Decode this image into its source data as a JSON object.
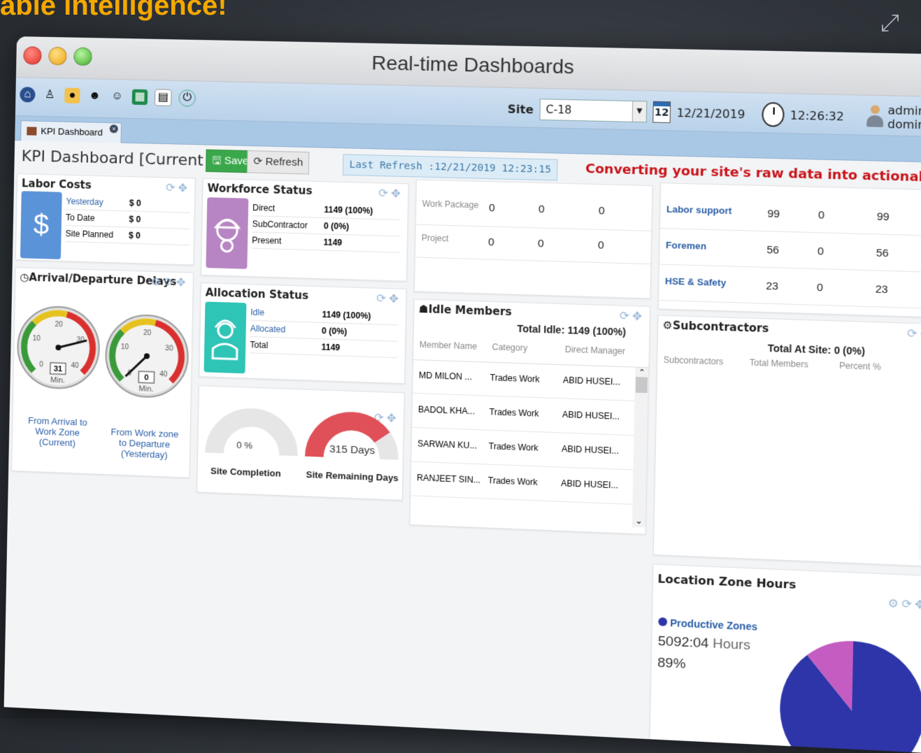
{
  "headline": "able intelligence!",
  "window": {
    "title": "Real-time Dashboards"
  },
  "toolbar": {
    "site_label": "Site",
    "site_value": "C-18",
    "date": "12/21/2019",
    "calendar_day": "12",
    "time": "12:26:32",
    "user": "admin-domina"
  },
  "tab": {
    "label": "KPI Dashboard",
    "close": "×"
  },
  "header": {
    "title": "KPI Dashboard [Current Shift]",
    "save_label": "Save",
    "refresh_label": "Refresh",
    "last_refresh": "Last Refresh :12/21/2019 12:23:15",
    "tagline": "Converting your site's raw data into actionable intelligence"
  },
  "labor_costs": {
    "title": "Labor Costs",
    "rows": [
      {
        "label": "Yesterday",
        "value": "$ 0"
      },
      {
        "label": "To Date",
        "value": "$ 0"
      },
      {
        "label": "Site Planned",
        "value": "$ 0"
      }
    ]
  },
  "workforce": {
    "title": "Workforce Status",
    "rows": [
      {
        "label": "Direct",
        "value": "1149 (100%)"
      },
      {
        "label": "SubContractor",
        "value": "0 (0%)"
      },
      {
        "label": "Present",
        "value": "1149"
      }
    ]
  },
  "packages": {
    "rows": [
      {
        "label": "Work Package",
        "a": "0",
        "b": "0",
        "c": "0"
      },
      {
        "label": "Project",
        "a": "0",
        "b": "0",
        "c": "0"
      }
    ]
  },
  "support": {
    "rows": [
      {
        "label": "Labor support",
        "a": "99",
        "b": "0",
        "c": "99"
      },
      {
        "label": "Foremen",
        "a": "56",
        "b": "0",
        "c": "56"
      },
      {
        "label": "HSE & Safety",
        "a": "23",
        "b": "0",
        "c": "23"
      }
    ]
  },
  "delays": {
    "title": "Arrival/Departure Delays",
    "gauge1": {
      "value": "31",
      "unit": "Min.",
      "caption_1": "From Arrival to",
      "caption_2": "Work Zone (Current)",
      "needle": 31
    },
    "gauge2": {
      "value": "0",
      "unit": "Min.",
      "caption_1": "From Work zone",
      "caption_2": "to Departure",
      "caption_3": "(Yesterday)",
      "needle": 0
    },
    "ticks": [
      "0",
      "10",
      "20",
      "30",
      "40"
    ]
  },
  "allocation": {
    "title": "Allocation Status",
    "rows": [
      {
        "label": "Idle",
        "value": "1149 (100%)"
      },
      {
        "label": "Allocated",
        "value": "0 (0%)"
      },
      {
        "label": "Total",
        "value": "1149"
      }
    ]
  },
  "completion": {
    "site_completion_value": "0 %",
    "site_completion_label": "Site Completion",
    "remaining_value": "315 Days",
    "remaining_label": "Site Remaining Days",
    "completion_fraction": 0,
    "remaining_fraction": 0.8
  },
  "idle": {
    "title": "Idle Members",
    "total": "Total Idle: 1149 (100%)",
    "columns": [
      "Member Name",
      "Category",
      "Direct Manager"
    ],
    "rows": [
      {
        "name": "MD MILON ...",
        "category": "Trades Work",
        "manager": "ABID HUSEI..."
      },
      {
        "name": "BADOL KHA...",
        "category": "Trades Work",
        "manager": "ABID HUSEI..."
      },
      {
        "name": "SARWAN KU...",
        "category": "Trades Work",
        "manager": "ABID HUSEI..."
      },
      {
        "name": "RANJEET SIN...",
        "category": "Trades Work",
        "manager": "ABID HUSEI..."
      }
    ]
  },
  "subcontractors": {
    "title": "Subcontractors",
    "total": "Total At Site: 0 (0%)",
    "columns": [
      "Subcontractors",
      "Total Members",
      "Percent %"
    ]
  },
  "location": {
    "title": "Location Zone Hours",
    "legend": "Productive Zones",
    "hours_value": "5092:04",
    "hours_unit": "Hours",
    "percent": "89%",
    "productive_fraction": 0.89,
    "colors": {
      "productive": "#2e35a8",
      "other": "#c45cc1"
    }
  }
}
